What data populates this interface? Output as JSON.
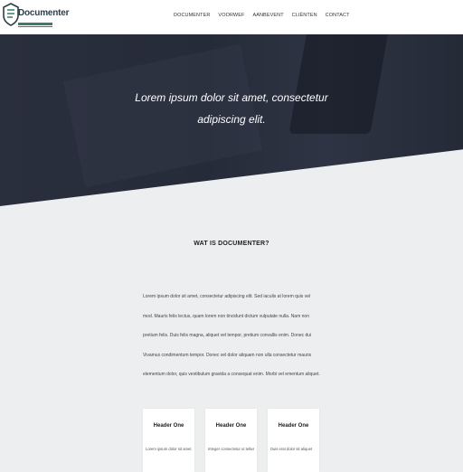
{
  "brand": {
    "name": "Documenter"
  },
  "nav": [
    "DOCUMENTER",
    "VOORWEF",
    "AANBEVENT",
    "CLIËNTEN",
    "CONTACT"
  ],
  "hero": {
    "line1": "Lorem ipsum dolor sit amet, consectetur",
    "line2": "adipiscing elit."
  },
  "section": {
    "title": "WAT IS DOCUMENTER?",
    "paragraph": "Lorem ipsum dolor sit amet, consectetur adipiscing elit. Sed iaculis at lorem quis vel mod. Mauris felis lectus, quam lorem non tincidunt dictum vulputate nulla. Nam non pretium felis. Duis felis magna, aliquet vel tempor, pretium convallis enim. Donec dui Vivamus condimentum tempor. Donec vel dolor aliquam non ulla consectetur mauris elementum dolor, quis vestibulum gravida a consequat enim. Morbi vel ementum aliquet."
  },
  "cards": [
    {
      "header": "Header One",
      "text": "Lorem ipsum dolor sit amet,"
    },
    {
      "header": "Header One",
      "text": "Integer consectetur ut tellus"
    },
    {
      "header": "Header One",
      "text": "Duis erat dolor sit aliquet"
    }
  ],
  "colors": {
    "hero": "#262b39",
    "accent": "#3f7a6a",
    "bg": "#eceeef"
  }
}
